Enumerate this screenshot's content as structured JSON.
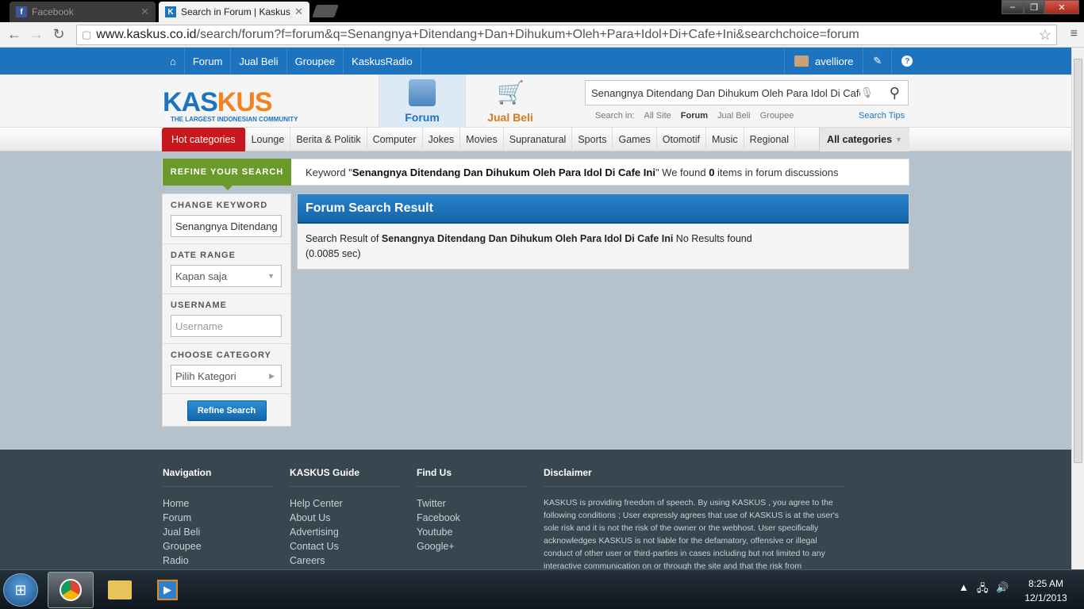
{
  "browser": {
    "tabs": [
      {
        "label": "Facebook",
        "favicon": "f"
      },
      {
        "label": "Search in Forum | Kaskus",
        "favicon": "K"
      }
    ],
    "url_domain": "www.kaskus.co.id",
    "url_path": "/search/forum?f=forum&q=Senangnya+Ditendang+Dan+Dihukum+Oleh+Para+Idol+Di+Cafe+Ini&searchchoice=forum"
  },
  "topnav": {
    "items": [
      "Forum",
      "Jual Beli",
      "Groupee",
      "KaskusRadio"
    ],
    "username": "avelliore"
  },
  "header": {
    "logo_main": "KASKUS",
    "logo_tagline": "THE LARGEST INDONESIAN COMMUNITY",
    "forum_label": "Forum",
    "jualbeli_label": "Jual Beli",
    "search_value": "Senangnya Ditendang Dan Dihukum Oleh Para Idol Di Cafe",
    "search_in_label": "Search in:",
    "search_in_options": [
      "All Site",
      "Forum",
      "Jual Beli",
      "Groupee"
    ],
    "search_tips": "Search Tips"
  },
  "categories": {
    "hot": "Hot categories",
    "items": [
      "Lounge",
      "Berita & Politik",
      "Computer",
      "Jokes",
      "Movies",
      "Supranatural",
      "Sports",
      "Games",
      "Otomotif",
      "Music",
      "Regional"
    ],
    "all": "All categories"
  },
  "refine": {
    "label": "REFINE YOUR SEARCH",
    "keyword_prefix": "Keyword \"",
    "keyword": "Senangnya Ditendang Dan Dihukum Oleh Para Idol Di Cafe Ini",
    "keyword_mid": "\" We found ",
    "count": "0",
    "keyword_suffix": " items in forum discussions"
  },
  "sidebar": {
    "change_keyword_title": "CHANGE KEYWORD",
    "keyword_value": "Senangnya Ditendang",
    "date_range_title": "DATE RANGE",
    "date_range_value": "Kapan saja",
    "username_title": "USERNAME",
    "username_placeholder": "Username",
    "category_title": "CHOOSE CATEGORY",
    "category_value": "Pilih Kategori",
    "button": "Refine Search"
  },
  "results": {
    "title": "Forum Search Result",
    "prefix": "Search Result of ",
    "keyword": "Senangnya Ditendang Dan Dihukum Oleh Para Idol Di Cafe Ini",
    "suffix": " No Results found",
    "time": "(0.0085 sec)"
  },
  "footer": {
    "navigation": {
      "title": "Navigation",
      "links": [
        "Home",
        "Forum",
        "Jual Beli",
        "Groupee",
        "Radio"
      ]
    },
    "guide": {
      "title": "KASKUS Guide",
      "links": [
        "Help Center",
        "About Us",
        "Advertising",
        "Contact Us",
        "Careers"
      ]
    },
    "findus": {
      "title": "Find Us",
      "links": [
        "Twitter",
        "Facebook",
        "Youtube",
        "Google+"
      ]
    },
    "disclaimer": {
      "title": "Disclaimer",
      "text": "KASKUS is providing freedom of speech. By using KASKUS , you agree to the following conditions ; User expressly agrees that use of KASKUS is at the user's sole risk and it is not the risk of the owner or the webhost. User specifically acknowledges KASKUS is not liable for the defamatory, offensive or illegal conduct of other user or third-parties in cases including but not limited to any interactive communication on or through the site and that the risk from"
    }
  },
  "taskbar": {
    "time": "8:25 AM",
    "date": "12/1/2013"
  },
  "colors": {
    "brand_blue": "#1e73be",
    "hot_red": "#c8161d",
    "refine_green": "#6a9a2a",
    "footer_bg": "#37464f"
  }
}
